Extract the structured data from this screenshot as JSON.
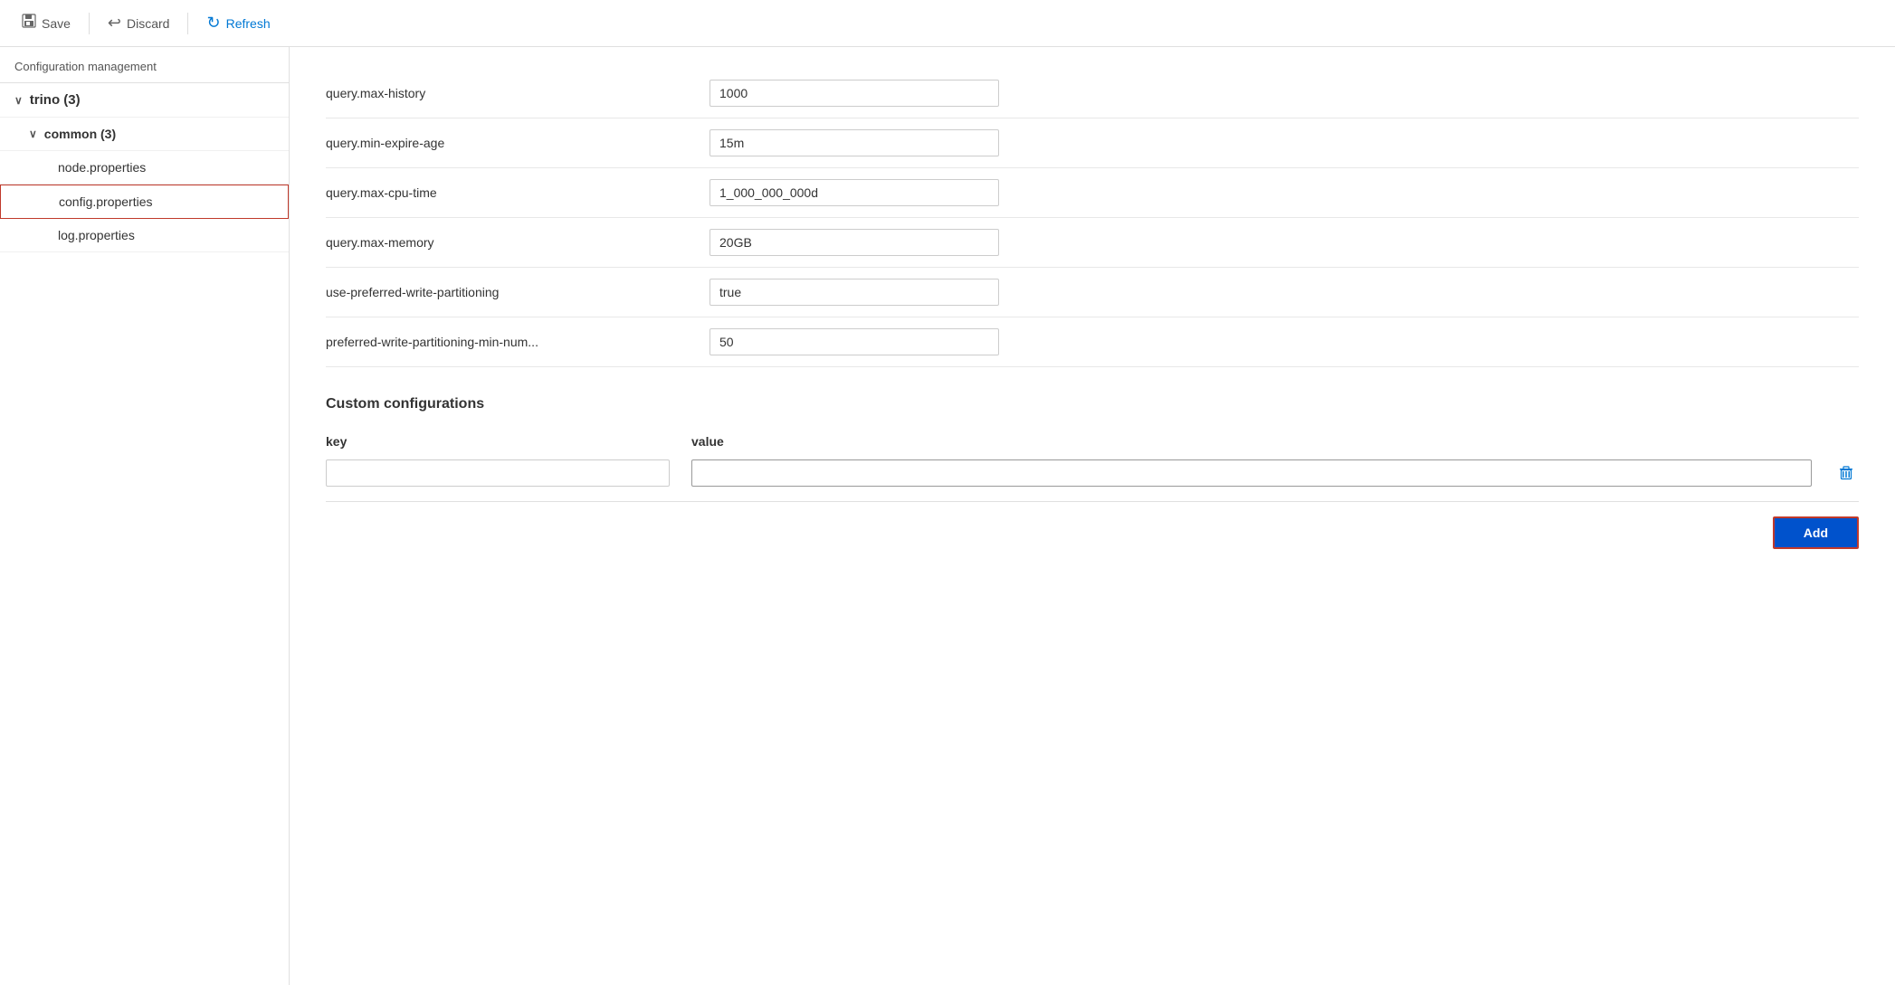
{
  "toolbar": {
    "save_label": "Save",
    "discard_label": "Discard",
    "refresh_label": "Refresh"
  },
  "sidebar": {
    "title": "Configuration management",
    "tree": [
      {
        "id": "trino",
        "label": "trino (3)",
        "level": 0,
        "expanded": true,
        "selected": false
      },
      {
        "id": "common",
        "label": "common (3)",
        "level": 1,
        "expanded": true,
        "selected": false
      },
      {
        "id": "node-properties",
        "label": "node.properties",
        "level": 2,
        "expanded": false,
        "selected": false
      },
      {
        "id": "config-properties",
        "label": "config.properties",
        "level": 2,
        "expanded": false,
        "selected": true
      },
      {
        "id": "log-properties",
        "label": "log.properties",
        "level": 2,
        "expanded": false,
        "selected": false
      }
    ]
  },
  "config": {
    "rows": [
      {
        "id": "query-max-history",
        "label": "query.max-history",
        "value": "1000"
      },
      {
        "id": "query-min-expire-age",
        "label": "query.min-expire-age",
        "value": "15m"
      },
      {
        "id": "query-max-cpu-time",
        "label": "query.max-cpu-time",
        "value": "1_000_000_000d"
      },
      {
        "id": "query-max-memory",
        "label": "query.max-memory",
        "value": "20GB"
      },
      {
        "id": "use-preferred-write-partitioning",
        "label": "use-preferred-write-partitioning",
        "value": "true"
      },
      {
        "id": "preferred-write-partitioning-min-num",
        "label": "preferred-write-partitioning-min-num...",
        "value": "50"
      }
    ],
    "custom_section_title": "Custom configurations",
    "custom_key_label": "key",
    "custom_value_label": "value",
    "add_button_label": "Add"
  },
  "icons": {
    "save": "💾",
    "discard": "↩",
    "refresh": "↻",
    "chevron_down": "∨",
    "trash": "🗑"
  }
}
